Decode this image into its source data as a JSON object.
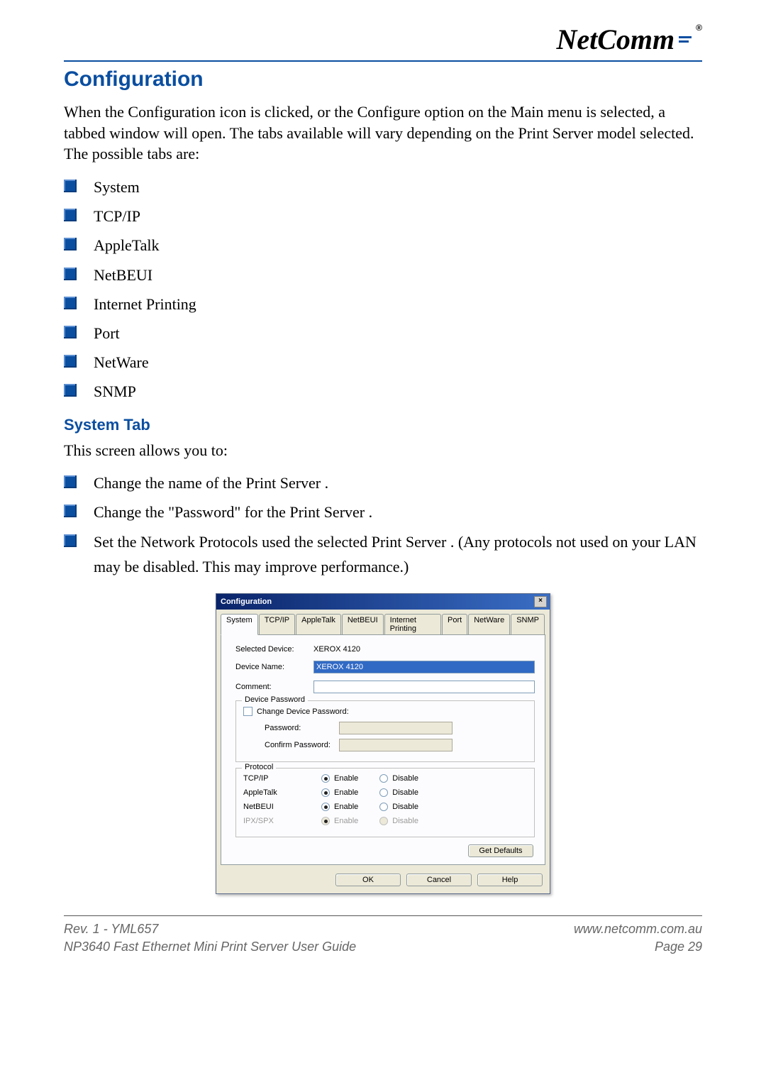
{
  "logo_text": "NetComm",
  "section_title": "Configuration",
  "intro_paragraph": "When the Configuration icon is clicked, or the Configure option on the Main menu is selected, a tabbed window will open. The tabs available will vary depending on the Print Server model selected. The possible tabs are:",
  "tab_list": [
    "System",
    "TCP/IP",
    "AppleTalk",
    "NetBEUI",
    "Internet Printing",
    "Port",
    "NetWare",
    "SNMP"
  ],
  "subsection_title": "System Tab",
  "subsection_intro": "This screen allows you to:",
  "action_list": [
    "Change the name of the Print Server .",
    "Change the \"Password\" for the Print Server .",
    "Set the Network Protocols used the selected Print Server . (Any protocols not used on your LAN may be disabled. This may improve performance.)"
  ],
  "dialog": {
    "title": "Configuration",
    "tabs": [
      "System",
      "TCP/IP",
      "AppleTalk",
      "NetBEUI",
      "Internet Printing",
      "Port",
      "NetWare",
      "SNMP"
    ],
    "selected_device_label": "Selected Device:",
    "selected_device_value": "XEROX 4120",
    "device_name_label": "Device Name:",
    "device_name_value": "XEROX 4120",
    "comment_label": "Comment:",
    "comment_value": "",
    "password_group": "Device Password",
    "change_password_label": "Change Device Password:",
    "password_label": "Password:",
    "confirm_password_label": "Confirm Password:",
    "protocol_group": "Protocol",
    "protocols": [
      {
        "name": "TCP/IP",
        "enabled": true,
        "disabled_control": false
      },
      {
        "name": "AppleTalk",
        "enabled": true,
        "disabled_control": false
      },
      {
        "name": "NetBEUI",
        "enabled": true,
        "disabled_control": false
      },
      {
        "name": "IPX/SPX",
        "enabled": true,
        "disabled_control": true
      }
    ],
    "enable_label": "Enable",
    "disable_label": "Disable",
    "get_defaults": "Get Defaults",
    "ok": "OK",
    "cancel": "Cancel",
    "help": "Help"
  },
  "footer": {
    "rev": "Rev. 1 - YML657",
    "url": "www.netcomm.com.au",
    "guide": "NP3640 Fast Ethernet Mini Print Server User Guide",
    "page": "Page 29"
  }
}
